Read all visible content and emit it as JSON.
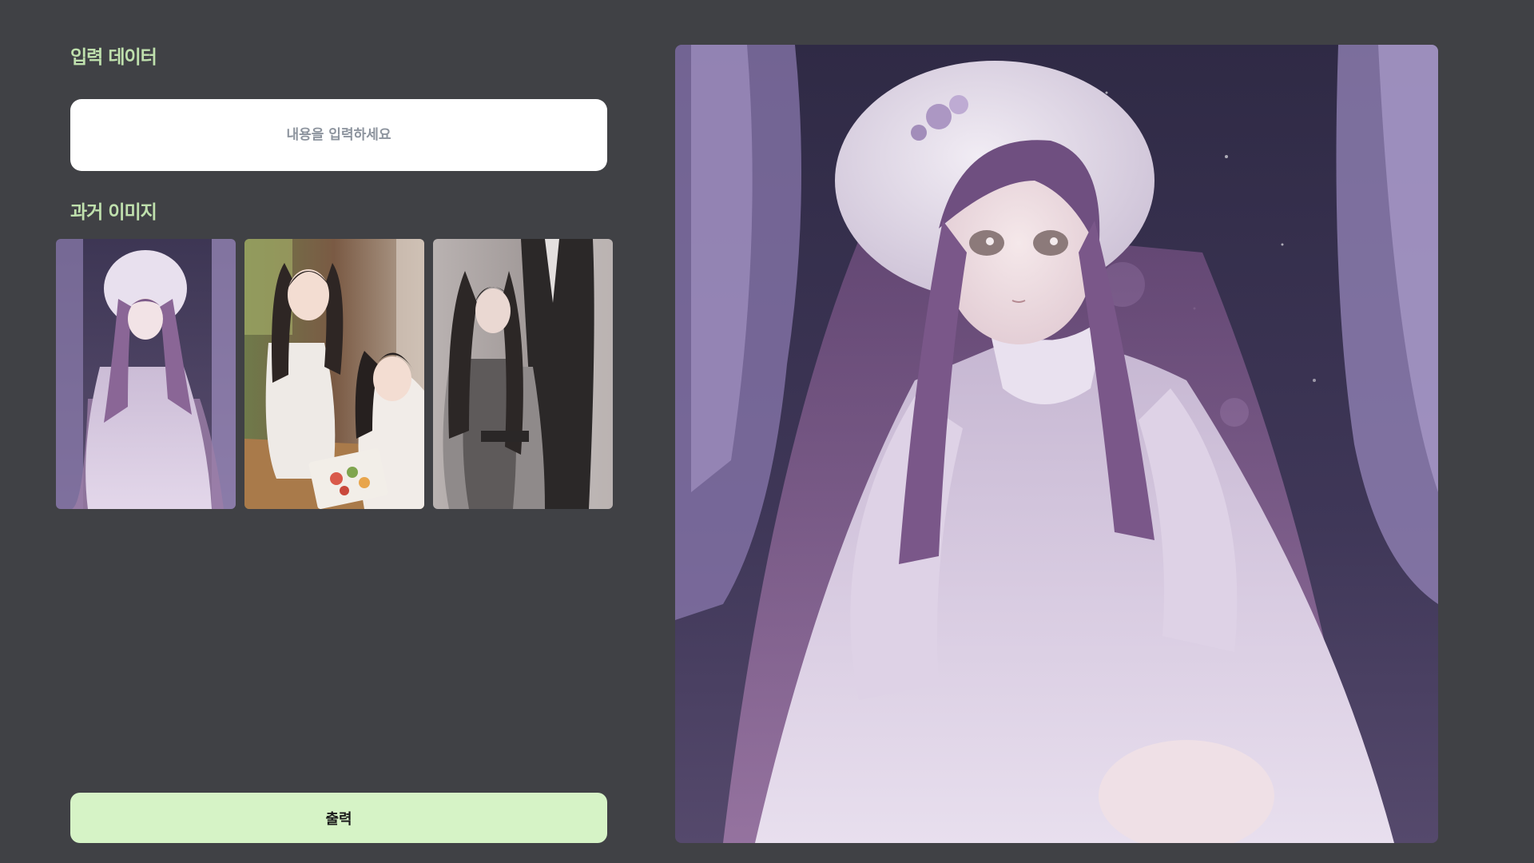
{
  "input_section": {
    "title": "입력 데이터",
    "placeholder": "내용을 입력하세요",
    "value": ""
  },
  "past_images_section": {
    "title": "과거 이미지",
    "thumbnails": [
      {
        "subject": "anime girl in white hat and lavender dress at night"
      },
      {
        "subject": "two anime girls eating at a table"
      },
      {
        "subject": "anime girl in grey dress beside a figure in black suit"
      }
    ]
  },
  "output_button": {
    "label": "출력"
  },
  "main_image": {
    "subject": "anime girl with long purple hair, white hat and lace dress, starry night with lavender trees"
  },
  "colors": {
    "background": "#404145",
    "title_text": "#bfe0ad",
    "input_background": "#ffffff",
    "placeholder_text": "#8d949e",
    "button_background": "#d6f3c6",
    "button_text": "#1c1c1c"
  }
}
